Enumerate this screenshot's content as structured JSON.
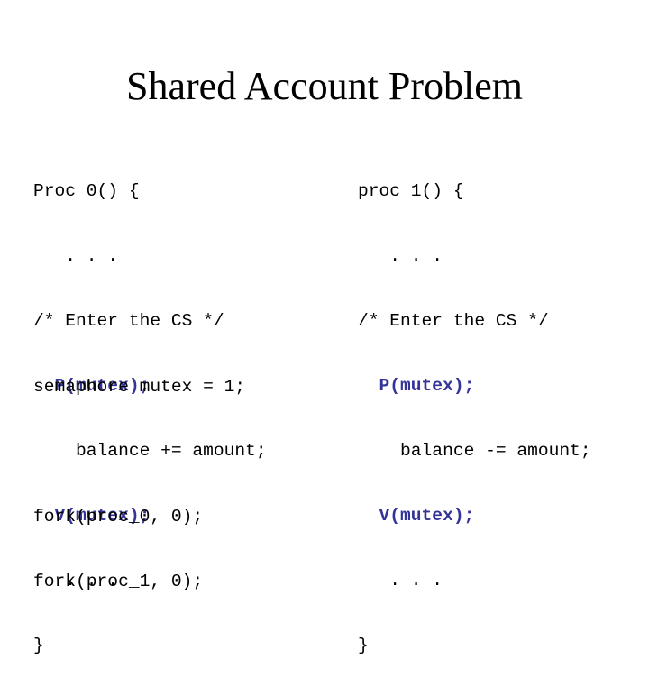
{
  "slide": {
    "title": "Shared Account Problem",
    "accent_color": "#333399",
    "left_code": [
      {
        "text": "Proc_0() {",
        "highlight": false
      },
      {
        "text": "   . . .",
        "highlight": false
      },
      {
        "text": "/* Enter the CS */",
        "highlight": false
      },
      {
        "text": "  P(mutex);",
        "highlight": true
      },
      {
        "text": "    balance += amount;",
        "highlight": false
      },
      {
        "text": "  V(mutex);",
        "highlight": true
      },
      {
        "text": "   . . .",
        "highlight": false
      },
      {
        "text": "}",
        "highlight": false
      }
    ],
    "right_code": [
      {
        "text": "proc_1() {",
        "highlight": false
      },
      {
        "text": "   . . .",
        "highlight": false
      },
      {
        "text": "/* Enter the CS */",
        "highlight": false
      },
      {
        "text": "  P(mutex);",
        "highlight": true
      },
      {
        "text": "    balance -= amount;",
        "highlight": false
      },
      {
        "text": "  V(mutex);",
        "highlight": true
      },
      {
        "text": "   . . .",
        "highlight": false
      },
      {
        "text": "}",
        "highlight": false
      }
    ],
    "setup_code": [
      {
        "text": "semaphore mutex = 1;",
        "highlight": false
      },
      {
        "text": "",
        "highlight": false
      },
      {
        "text": "fork(proc_0, 0);",
        "highlight": false
      },
      {
        "text": "fork(proc_1, 0);",
        "highlight": false
      }
    ]
  }
}
